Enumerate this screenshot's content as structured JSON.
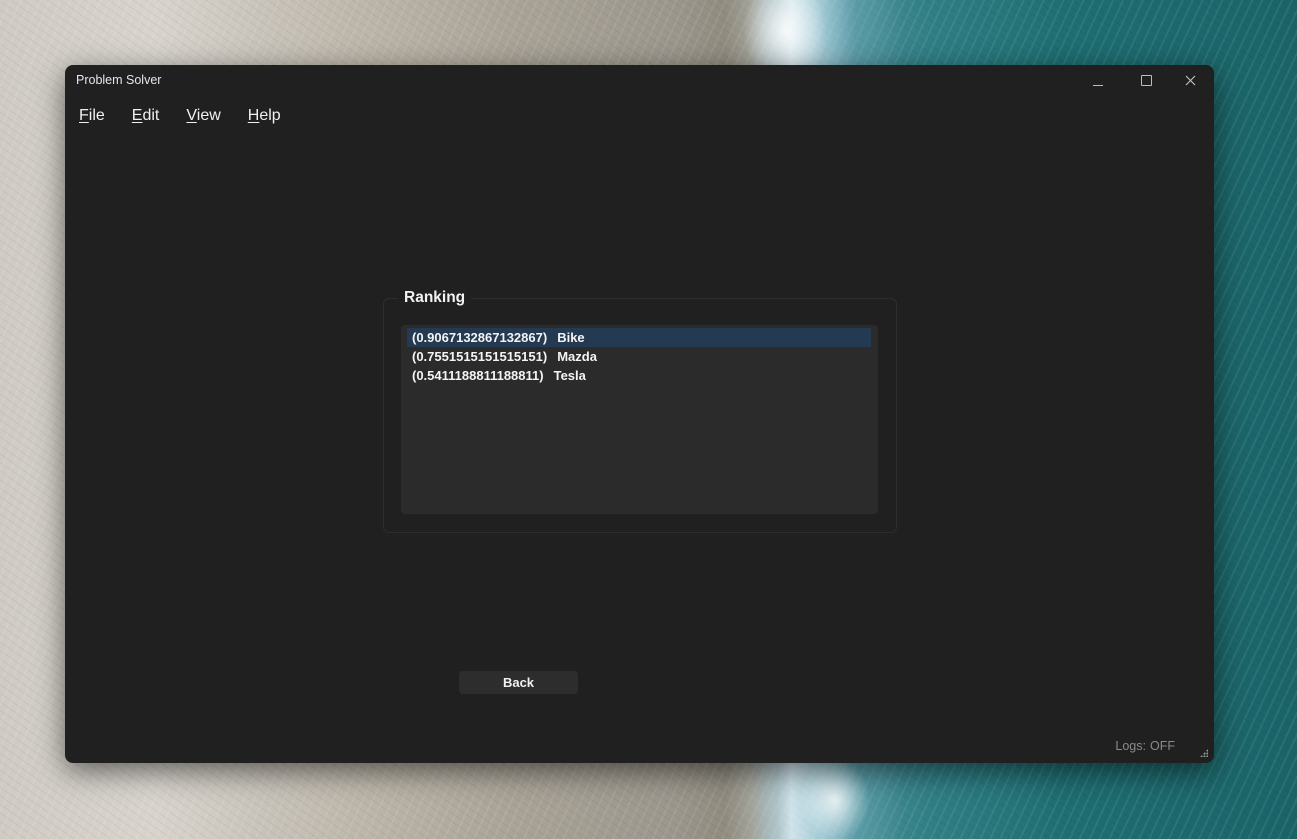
{
  "window": {
    "title": "Problem Solver",
    "controls": [
      "minimize-icon",
      "maximize-icon",
      "close-icon"
    ]
  },
  "menu": [
    {
      "label_first": "F",
      "label_rest": "ile"
    },
    {
      "label_first": "E",
      "label_rest": "dit"
    },
    {
      "label_first": "V",
      "label_rest": "iew"
    },
    {
      "label_first": "H",
      "label_rest": "elp"
    }
  ],
  "ranking": {
    "title": "Ranking",
    "items": [
      {
        "score": "(0.9067132867132867)",
        "name": "Bike"
      },
      {
        "score": "(0.7551515151515151)",
        "name": "Mazda"
      },
      {
        "score": "(0.5411188811188811)",
        "name": "Tesla"
      }
    ],
    "selected_index": 0
  },
  "back_button": {
    "label": "Back"
  },
  "status": {
    "logs_label": "Logs:",
    "logs_value": "OFF"
  },
  "colors": {
    "window_bg": "#202020",
    "list_bg": "#2b2b2b",
    "selection": "#243a52",
    "button_bg": "#2d2d2d"
  }
}
